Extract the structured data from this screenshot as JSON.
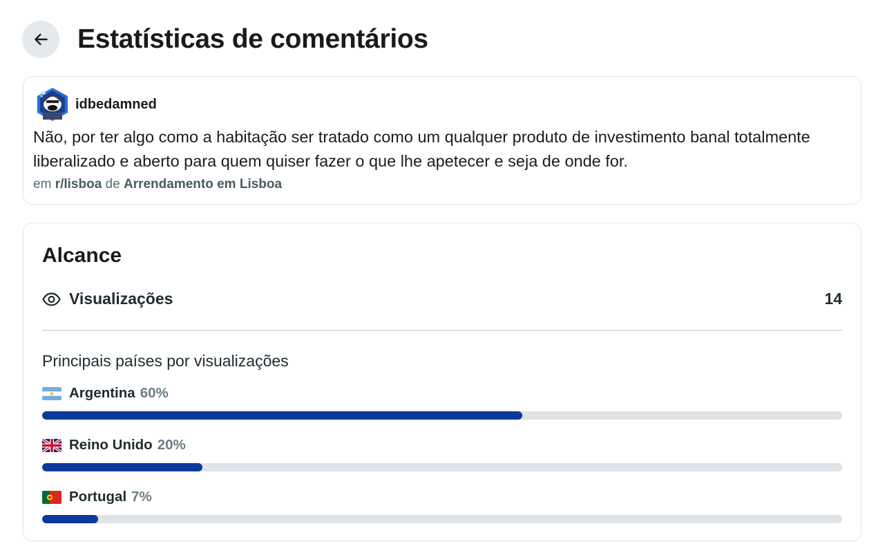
{
  "header": {
    "title": "Estatísticas de comentários",
    "back_icon": "arrow-left-icon"
  },
  "comment": {
    "author": "idbedamned",
    "avatar_icon": "snoo-avatar-icon",
    "text": "Não, por ter algo como a habitação ser tratado como um qualquer produto de investimento banal totalmente liberalizado e aberto para quem quiser fazer o que lhe apetecer e seja de onde for.",
    "meta_prefix": "em",
    "subreddit": "r/lisboa",
    "meta_middle": "de",
    "post_title": "Arrendamento em Lisboa"
  },
  "reach": {
    "title": "Alcance",
    "views_icon": "eye-icon",
    "views_label": "Visualizações",
    "views_count": "14",
    "countries_heading": "Principais países por visualizações",
    "countries": [
      {
        "flag_icon": "flag-argentina-icon",
        "name": "Argentina",
        "pct_label": "60%",
        "pct": 60
      },
      {
        "flag_icon": "flag-united-kingdom-icon",
        "name": "Reino Unido",
        "pct_label": "20%",
        "pct": 20
      },
      {
        "flag_icon": "flag-portugal-icon",
        "name": "Portugal",
        "pct_label": "7%",
        "pct": 7
      }
    ],
    "bar_color": "#0b3a9b",
    "track_color": "#dde3e7"
  }
}
